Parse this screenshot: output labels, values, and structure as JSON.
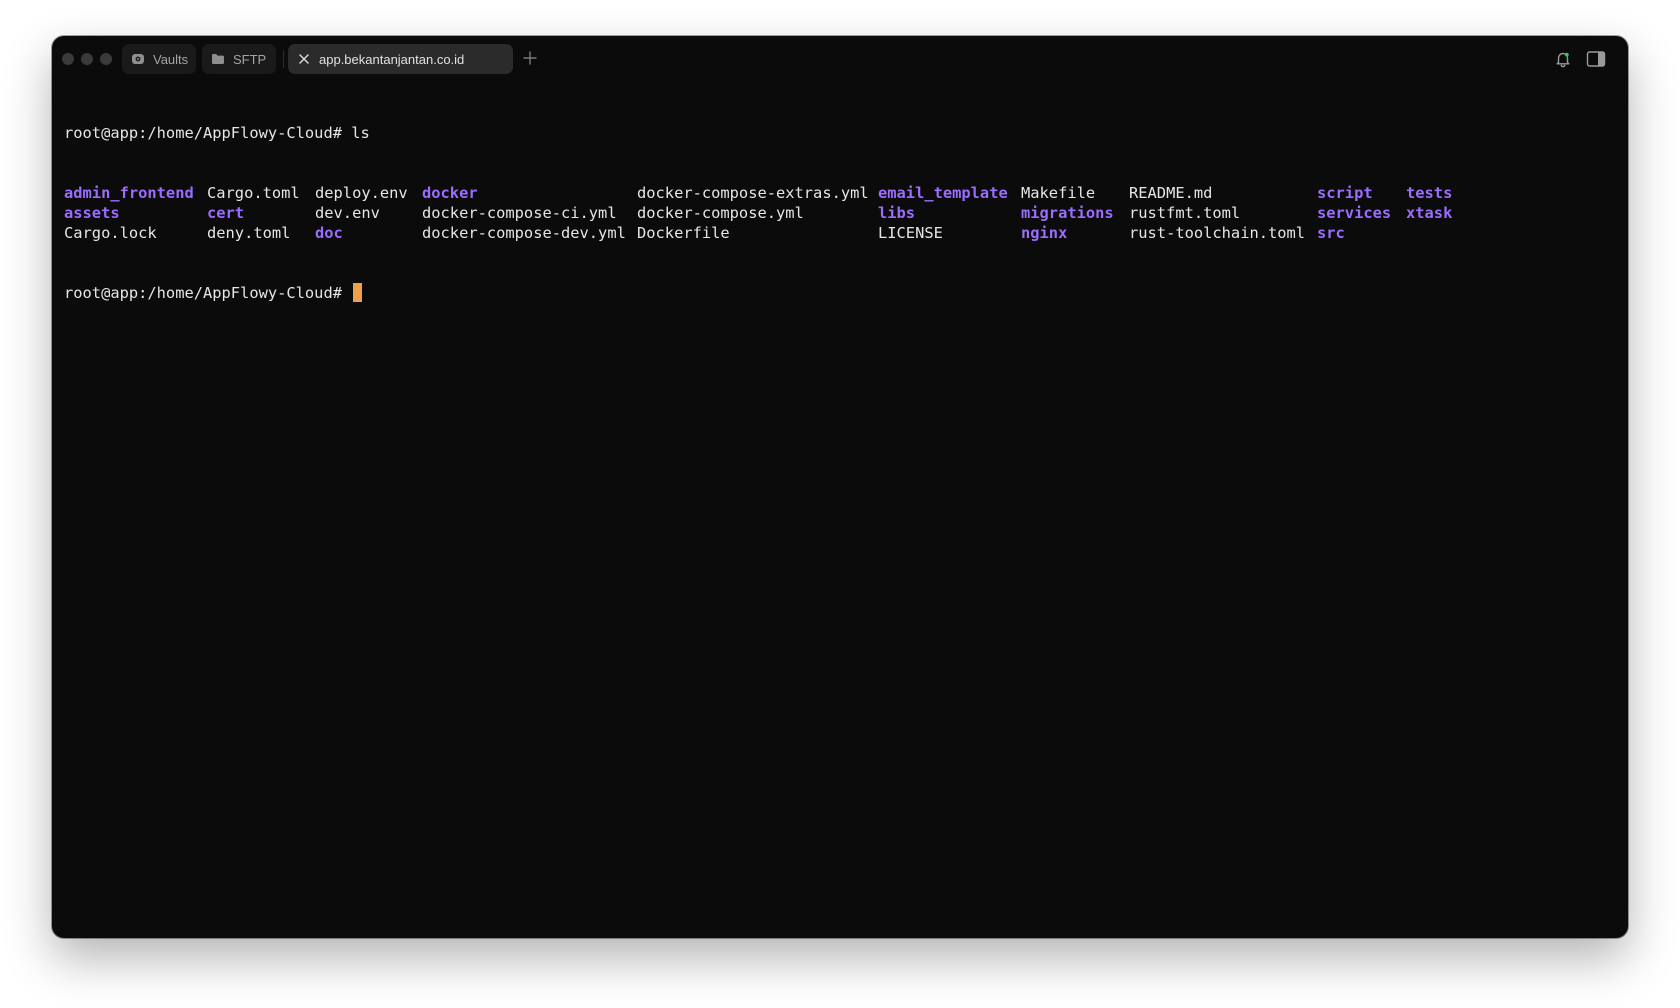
{
  "window": {
    "tabs": [
      {
        "label": "Vaults",
        "icon": "vault-icon"
      },
      {
        "label": "SFTP",
        "icon": "folder-icon"
      },
      {
        "label": "app.bekantanjantan.co.id",
        "icon": "close-icon",
        "active": true
      }
    ],
    "new_tab_icon": "plus-icon",
    "right_icons": [
      "bell-icon",
      "sidebar-toggle-icon"
    ]
  },
  "colors": {
    "background": "#0b0b0b",
    "text": "#e6e6e6",
    "directory": "#9c6cff",
    "cursor": "#f0a04b"
  },
  "terminal": {
    "prompt": "root@app:/home/AppFlowy-Cloud#",
    "command": "ls",
    "ls_rows": [
      [
        {
          "name": "admin_frontend",
          "dir": true
        },
        {
          "name": "Cargo.toml",
          "dir": false
        },
        {
          "name": "deploy.env",
          "dir": false
        },
        {
          "name": "docker",
          "dir": true
        },
        {
          "name": "docker-compose-extras.yml",
          "dir": false
        },
        {
          "name": "email_template",
          "dir": true
        },
        {
          "name": "Makefile",
          "dir": false
        },
        {
          "name": "README.md",
          "dir": false
        },
        {
          "name": "script",
          "dir": true
        },
        {
          "name": "tests",
          "dir": true
        }
      ],
      [
        {
          "name": "assets",
          "dir": true
        },
        {
          "name": "cert",
          "dir": true
        },
        {
          "name": "dev.env",
          "dir": false
        },
        {
          "name": "docker-compose-ci.yml",
          "dir": false
        },
        {
          "name": "docker-compose.yml",
          "dir": false
        },
        {
          "name": "libs",
          "dir": true
        },
        {
          "name": "migrations",
          "dir": true
        },
        {
          "name": "rustfmt.toml",
          "dir": false
        },
        {
          "name": "services",
          "dir": true
        },
        {
          "name": "xtask",
          "dir": true
        }
      ],
      [
        {
          "name": "Cargo.lock",
          "dir": false
        },
        {
          "name": "deny.toml",
          "dir": false
        },
        {
          "name": "doc",
          "dir": true
        },
        {
          "name": "docker-compose-dev.yml",
          "dir": false
        },
        {
          "name": "Dockerfile",
          "dir": false
        },
        {
          "name": "LICENSE",
          "dir": false
        },
        {
          "name": "nginx",
          "dir": true
        },
        {
          "name": "rust-toolchain.toml",
          "dir": false
        },
        {
          "name": "src",
          "dir": true
        }
      ]
    ]
  }
}
